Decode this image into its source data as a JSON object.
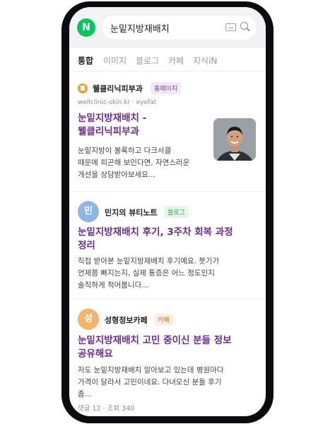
{
  "search": {
    "query": "눈밑지방재배치",
    "logo_letter": "N"
  },
  "tabs": [
    "통합",
    "이미지",
    "블로그",
    "카페",
    "지식iN"
  ],
  "results": [
    {
      "source": "웰클리닉피부과",
      "badge": "홈페이지",
      "url": "wellclinic-skin.kr · eyefat",
      "title_lines": [
        "눈밑지방재배치 -",
        "웰클리닉피부과"
      ],
      "snippet_lines": [
        "눈밑지방이 볼록하고 다크서클",
        "때문에 피곤해 보인다면, 자연스러운",
        "개선을 상담받아보세요..."
      ]
    },
    {
      "avatar": "민",
      "source": "민지의 뷰티노트",
      "badge": "블로그",
      "title_lines": [
        "눈밑지방재배치 후기, 3주차 회복 과정",
        "정리"
      ],
      "snippet_lines": [
        "직접 받아본 눈밑지방재배치 후기예요. 붓기가",
        "언제쯤 빠지는지, 실제 통증은 어느 정도인지",
        "솔직하게 적어봅니다..."
      ]
    },
    {
      "avatar": "성",
      "source": "성형정보카페",
      "badge": "카페",
      "title_lines": [
        "눈밑지방재배치 고민 중이신 분들 정보",
        "공유해요"
      ],
      "snippet_lines": [
        "저도 눈밑지방재배치 알아보고 있는데 병원마다",
        "가격이 달라서 고민이네요. 다녀오신 분들 후기",
        "좀..."
      ],
      "meta": "댓글 12 · 조회 340"
    }
  ],
  "colors": {
    "brand": "#03c75a",
    "title": "#6a2e8f",
    "homepage_badge": "#7b3fa0",
    "blog_badge": "#1fa34a",
    "cafe_badge": "#e0701e"
  }
}
